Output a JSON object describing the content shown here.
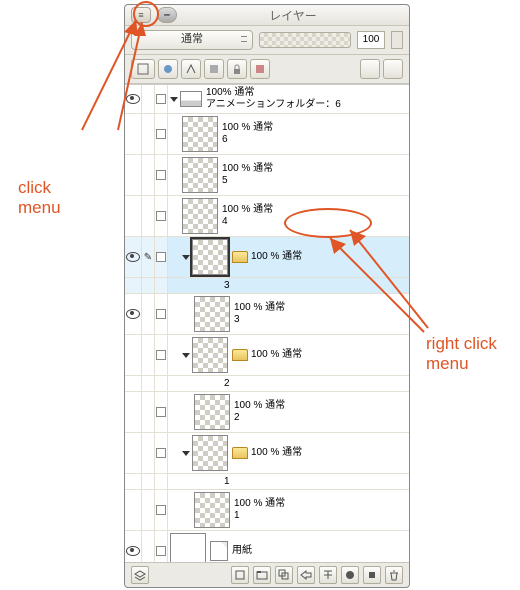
{
  "panel_title": "レイヤー",
  "blend_mode": "通常",
  "opacity_value": "100",
  "root_folder": {
    "opacity": "100% 通常",
    "name": "アニメーションフォルダー：6"
  },
  "layers": [
    {
      "label": "100 % 通常",
      "num": "6"
    },
    {
      "label": "100 % 通常",
      "num": "5"
    },
    {
      "label": "100 % 通常",
      "num": "4"
    }
  ],
  "groups": [
    {
      "label": "100 % 通常",
      "num": "3",
      "child": {
        "label": "100 % 通常",
        "num": "3"
      }
    },
    {
      "label": "100 % 通常",
      "num": "2",
      "child": {
        "label": "100 % 通常",
        "num": "2"
      }
    },
    {
      "label": "100 % 通常",
      "num": "1",
      "child": {
        "label": "100 % 通常",
        "num": "1"
      }
    }
  ],
  "paper_label": "用紙",
  "annotations": {
    "left_label_1": "click",
    "left_label_2": "menu",
    "right_label_1": "right click",
    "right_label_2": "menu"
  }
}
